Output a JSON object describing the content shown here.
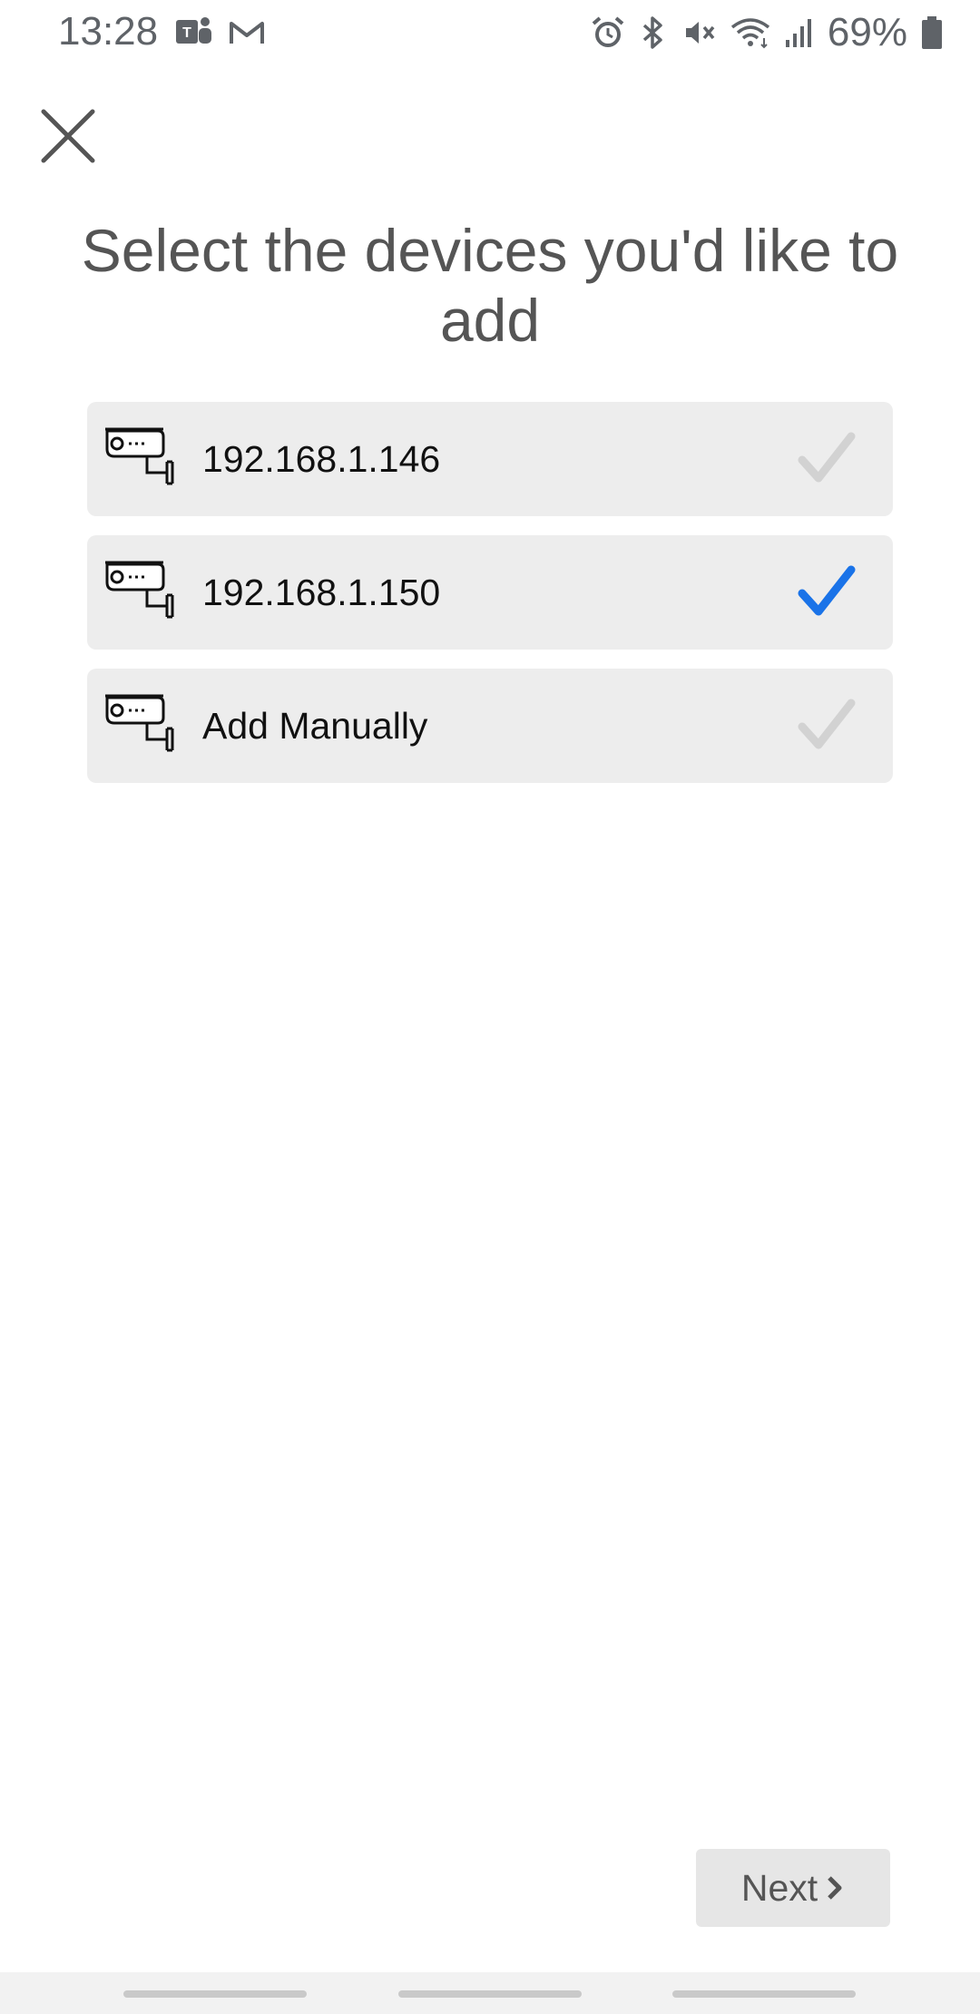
{
  "status_bar": {
    "time": "13:28",
    "battery_percent": "69%",
    "left_icons": [
      "teams-icon",
      "gmail-icon"
    ],
    "right_icons": [
      "alarm-icon",
      "bluetooth-icon",
      "mute-icon",
      "wifi-icon",
      "signal-icon",
      "battery-icon"
    ]
  },
  "header": {
    "close_icon": "close-icon",
    "title": "Select the devices you'd like to add"
  },
  "devices": [
    {
      "label": "192.168.1.146",
      "icon": "security-camera-icon",
      "selected": false
    },
    {
      "label": "192.168.1.150",
      "icon": "security-camera-icon",
      "selected": true
    },
    {
      "label": "Add Manually",
      "icon": "security-camera-icon",
      "selected": false
    }
  ],
  "footer": {
    "next_label": "Next",
    "next_icon": "chevron-right-icon"
  },
  "colors": {
    "accent": "#1a73e8",
    "check_inactive": "#d2d2d2",
    "item_bg": "#ededed",
    "title_text": "#555555"
  }
}
